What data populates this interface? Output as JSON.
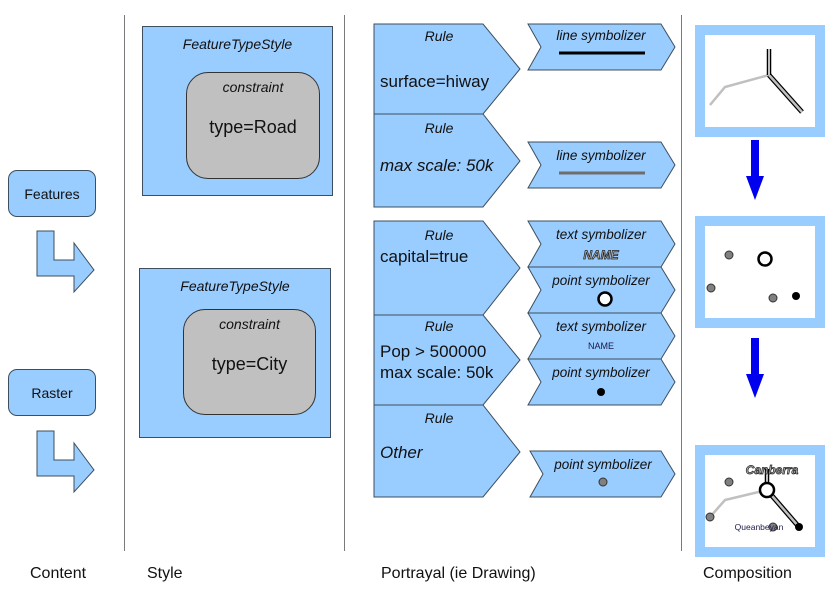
{
  "columns": {
    "content": "Content",
    "style": "Style",
    "portrayal": "Portrayal (ie Drawing)",
    "composition": "Composition"
  },
  "content": {
    "items": [
      {
        "label": "Features"
      },
      {
        "label": "Raster"
      }
    ]
  },
  "style": {
    "feature_type_styles": [
      {
        "title": "FeatureTypeStyle",
        "constraint_title": "constraint",
        "constraint_value": "type=Road"
      },
      {
        "title": "FeatureTypeStyle",
        "constraint_title": "constraint",
        "constraint_value": "type=City"
      }
    ]
  },
  "portrayal": {
    "rules": [
      {
        "title": "Rule",
        "lines": [
          "surface=hiway"
        ],
        "italic": false
      },
      {
        "title": "Rule",
        "lines": [
          "max scale: 50k"
        ],
        "italic": true
      },
      {
        "title": "Rule",
        "lines": [
          "capital=true"
        ],
        "italic": false
      },
      {
        "title": "Rule",
        "lines": [
          "Pop > 500000",
          "max scale: 50k"
        ],
        "italic": false
      },
      {
        "title": "Rule",
        "lines": [
          "Other"
        ],
        "italic": true
      }
    ],
    "symbolizers": [
      {
        "title": "line symbolizer",
        "sample": "black-line"
      },
      {
        "title": "line symbolizer",
        "sample": "gray-line"
      },
      {
        "title": "text symbolizer",
        "sample": "halo-text",
        "text": "NAME"
      },
      {
        "title": "point symbolizer",
        "sample": "hollow-circle"
      },
      {
        "title": "text symbolizer",
        "sample": "small-text",
        "text": "NAME"
      },
      {
        "title": "point symbolizer",
        "sample": "black-dot"
      },
      {
        "title": "point symbolizer",
        "sample": "gray-dot"
      }
    ]
  },
  "composition": {
    "labels": {
      "capital": "Canberra",
      "city": "Queanbeyan"
    },
    "arrow_color": "#0000ee"
  },
  "colors": {
    "shape_fill": "#99ccff",
    "shape_stroke": "#3d4f5e",
    "constraint_fill": "#c0c0c0"
  }
}
